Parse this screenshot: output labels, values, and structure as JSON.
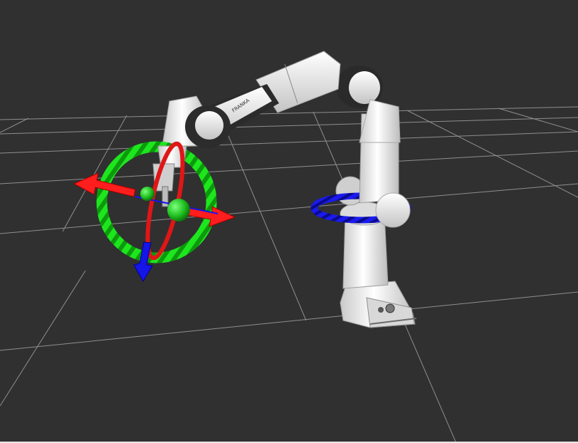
{
  "scene": {
    "background": "#303030",
    "grid_color": "#9a9a9a",
    "robot_body_color": "#f2f2f2",
    "robot_joint_color": "#2b2b2b",
    "robot_logo_text": "FRANKA",
    "interactive_marker": {
      "ring_color": "#18e018",
      "ring_alt_color": "#0fa80f",
      "x_axis_color": "#ff1a1a",
      "z_axis_color": "#1414e6",
      "handle_color": "#1fd11f"
    },
    "joint_marker": {
      "ring_color": "#1414e6",
      "ring_alt_color": "#0b0b9c"
    }
  }
}
